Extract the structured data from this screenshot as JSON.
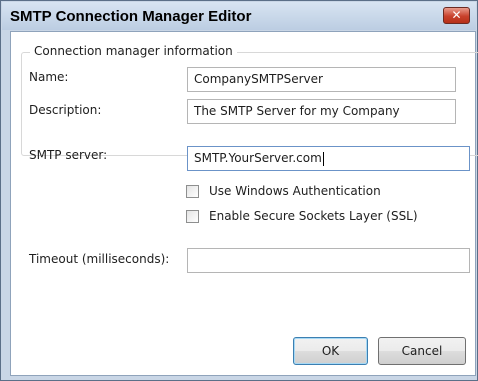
{
  "window": {
    "title": "SMTP Connection Manager Editor",
    "close_glyph": "✕"
  },
  "connection_info": {
    "legend": "Connection manager information",
    "name_label": "Name:",
    "name_value": "CompanySMTPServer",
    "description_label": "Description:",
    "description_value": "The SMTP Server for my Company"
  },
  "smtp": {
    "server_label": "SMTP server:",
    "server_value": "SMTP.YourServer.com",
    "windows_auth_label": "Use Windows Authentication",
    "windows_auth_checked": false,
    "ssl_label": "Enable Secure Sockets Layer (SSL)",
    "ssl_checked": false,
    "timeout_label": "Timeout (milliseconds):",
    "timeout_value": ""
  },
  "buttons": {
    "ok_label": "OK",
    "cancel_label": "Cancel"
  },
  "colors": {
    "title_bar": "#c9d6e6",
    "close_button": "#c8412c",
    "focus_border": "#6b93c8",
    "default_button_border": "#3c7fb1"
  }
}
